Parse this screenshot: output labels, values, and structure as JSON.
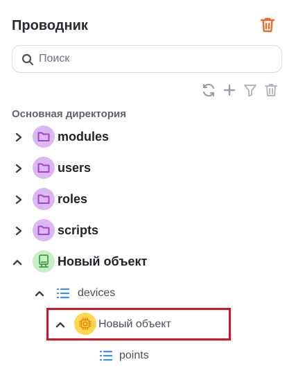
{
  "header": {
    "title": "Проводник",
    "trash_icon": "trash-icon",
    "accent_color": "#f2682a"
  },
  "search": {
    "placeholder": "Поиск",
    "value": ""
  },
  "toolbar": {
    "icons": [
      "refresh-icon",
      "plus-icon",
      "filter-icon",
      "trash-icon"
    ]
  },
  "tree": {
    "root_label": "Основная директория",
    "items": [
      {
        "label": "modules",
        "icon": "folder-icon",
        "expanded": false
      },
      {
        "label": "users",
        "icon": "folder-icon",
        "expanded": false
      },
      {
        "label": "roles",
        "icon": "folder-icon",
        "expanded": false
      },
      {
        "label": "scripts",
        "icon": "folder-icon",
        "expanded": false
      },
      {
        "label": "Новый объект",
        "icon": "device-icon",
        "expanded": true
      },
      {
        "label": "devices",
        "icon": "list-icon",
        "expanded": true
      },
      {
        "label": "Новый объект",
        "icon": "chip-icon",
        "expanded": true,
        "selected": true
      },
      {
        "label": "points",
        "icon": "list-icon"
      }
    ]
  },
  "colors": {
    "folder": "#d9b3f0",
    "device": "#c7ecc2",
    "chip": "#ffd54f",
    "list": "#3d8fe6",
    "selection": "#d6141d"
  }
}
